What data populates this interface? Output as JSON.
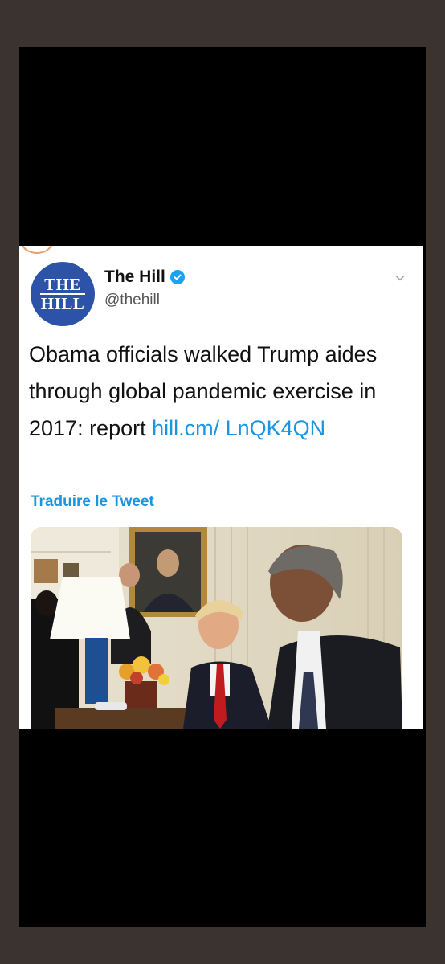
{
  "tweet": {
    "account_name": "The Hill",
    "handle": "@thehill",
    "avatar_text": {
      "line1": "THE",
      "line2": "HILL"
    },
    "text": "Obama officials walked Trump aides through global pandemic exercise in 2017: report ",
    "link_text": "hill.cm/ LnQK4QN",
    "translate_label": "Traduire le Tweet"
  },
  "icons": {
    "verified": "verified-badge-icon",
    "menu": "chevron-down-icon"
  },
  "colors": {
    "link": "#1b95e0",
    "avatar_bg": "#2c53a8",
    "background": "#3b3330"
  }
}
